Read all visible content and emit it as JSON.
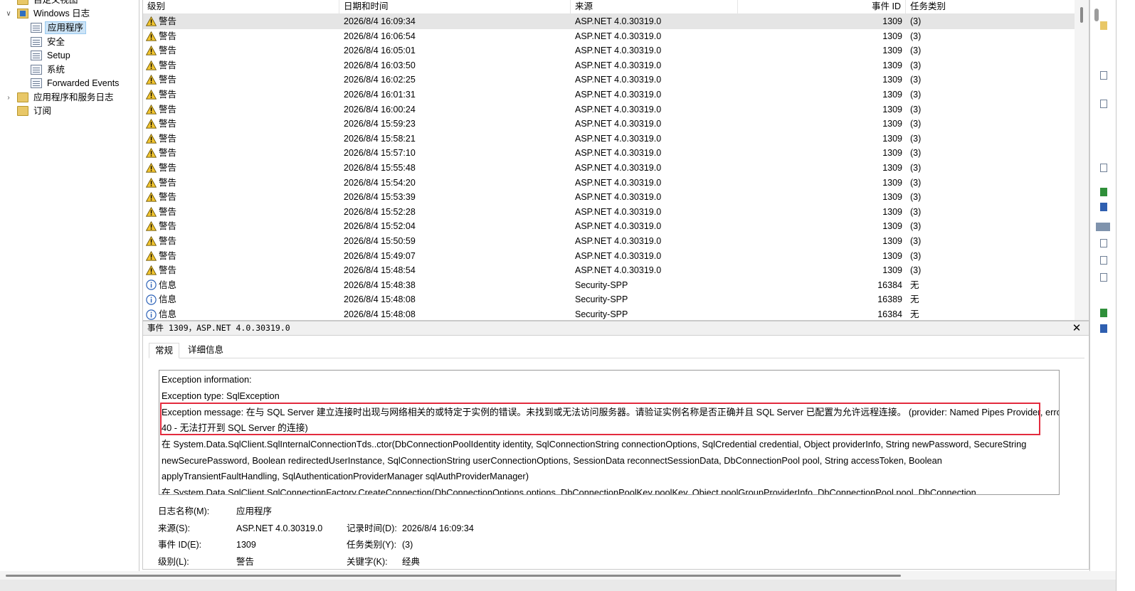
{
  "tree": {
    "custom_views": "自定义视图",
    "windows_logs": "Windows 日志",
    "items": [
      "应用程序",
      "安全",
      "Setup",
      "系统",
      "Forwarded Events"
    ],
    "app_service_logs": "应用程序和服务日志",
    "subscriptions": "订阅"
  },
  "list": {
    "headers": {
      "level": "级别",
      "datetime": "日期和时间",
      "source": "来源",
      "event_id": "事件 ID",
      "task": "任务类别"
    },
    "rows": [
      {
        "level": "警告",
        "type": "warning",
        "datetime": "2026/8/4 16:09:34",
        "source": "ASP.NET 4.0.30319.0",
        "event_id": "1309",
        "task": "(3)"
      },
      {
        "level": "警告",
        "type": "warning",
        "datetime": "2026/8/4 16:06:54",
        "source": "ASP.NET 4.0.30319.0",
        "event_id": "1309",
        "task": "(3)"
      },
      {
        "level": "警告",
        "type": "warning",
        "datetime": "2026/8/4 16:05:01",
        "source": "ASP.NET 4.0.30319.0",
        "event_id": "1309",
        "task": "(3)"
      },
      {
        "level": "警告",
        "type": "warning",
        "datetime": "2026/8/4 16:03:50",
        "source": "ASP.NET 4.0.30319.0",
        "event_id": "1309",
        "task": "(3)"
      },
      {
        "level": "警告",
        "type": "warning",
        "datetime": "2026/8/4 16:02:25",
        "source": "ASP.NET 4.0.30319.0",
        "event_id": "1309",
        "task": "(3)"
      },
      {
        "level": "警告",
        "type": "warning",
        "datetime": "2026/8/4 16:01:31",
        "source": "ASP.NET 4.0.30319.0",
        "event_id": "1309",
        "task": "(3)"
      },
      {
        "level": "警告",
        "type": "warning",
        "datetime": "2026/8/4 16:00:24",
        "source": "ASP.NET 4.0.30319.0",
        "event_id": "1309",
        "task": "(3)"
      },
      {
        "level": "警告",
        "type": "warning",
        "datetime": "2026/8/4 15:59:23",
        "source": "ASP.NET 4.0.30319.0",
        "event_id": "1309",
        "task": "(3)"
      },
      {
        "level": "警告",
        "type": "warning",
        "datetime": "2026/8/4 15:58:21",
        "source": "ASP.NET 4.0.30319.0",
        "event_id": "1309",
        "task": "(3)"
      },
      {
        "level": "警告",
        "type": "warning",
        "datetime": "2026/8/4 15:57:10",
        "source": "ASP.NET 4.0.30319.0",
        "event_id": "1309",
        "task": "(3)"
      },
      {
        "level": "警告",
        "type": "warning",
        "datetime": "2026/8/4 15:55:48",
        "source": "ASP.NET 4.0.30319.0",
        "event_id": "1309",
        "task": "(3)"
      },
      {
        "level": "警告",
        "type": "warning",
        "datetime": "2026/8/4 15:54:20",
        "source": "ASP.NET 4.0.30319.0",
        "event_id": "1309",
        "task": "(3)"
      },
      {
        "level": "警告",
        "type": "warning",
        "datetime": "2026/8/4 15:53:39",
        "source": "ASP.NET 4.0.30319.0",
        "event_id": "1309",
        "task": "(3)"
      },
      {
        "level": "警告",
        "type": "warning",
        "datetime": "2026/8/4 15:52:28",
        "source": "ASP.NET 4.0.30319.0",
        "event_id": "1309",
        "task": "(3)"
      },
      {
        "level": "警告",
        "type": "warning",
        "datetime": "2026/8/4 15:52:04",
        "source": "ASP.NET 4.0.30319.0",
        "event_id": "1309",
        "task": "(3)"
      },
      {
        "level": "警告",
        "type": "warning",
        "datetime": "2026/8/4 15:50:59",
        "source": "ASP.NET 4.0.30319.0",
        "event_id": "1309",
        "task": "(3)"
      },
      {
        "level": "警告",
        "type": "warning",
        "datetime": "2026/8/4 15:49:07",
        "source": "ASP.NET 4.0.30319.0",
        "event_id": "1309",
        "task": "(3)"
      },
      {
        "level": "警告",
        "type": "warning",
        "datetime": "2026/8/4 15:48:54",
        "source": "ASP.NET 4.0.30319.0",
        "event_id": "1309",
        "task": "(3)"
      },
      {
        "level": "信息",
        "type": "info",
        "datetime": "2026/8/4 15:48:38",
        "source": "Security-SPP",
        "event_id": "16384",
        "task": "无"
      },
      {
        "level": "信息",
        "type": "info",
        "datetime": "2026/8/4 15:48:08",
        "source": "Security-SPP",
        "event_id": "16389",
        "task": "无"
      },
      {
        "level": "信息",
        "type": "info",
        "datetime": "2026/8/4 15:48:08",
        "source": "Security-SPP",
        "event_id": "16384",
        "task": "无"
      }
    ]
  },
  "details": {
    "title": "事件 1309，ASP.NET 4.0.30319.0",
    "tabs": [
      "常规",
      "详细信息"
    ],
    "message_lines": [
      "Exception information:",
      "    Exception type: SqlException",
      "    Exception message: 在与 SQL Server 建立连接时出现与网络相关的或特定于实例的错误。未找到或无法访问服务器。请验证实例名称是否正确并且 SQL Server 已配置为允许远程连接。 (provider: Named Pipes Provider, error:",
      "40 - 无法打开到 SQL Server 的连接)",
      "   在 System.Data.SqlClient.SqlInternalConnectionTds..ctor(DbConnectionPoolIdentity identity, SqlConnectionString connectionOptions, SqlCredential credential, Object providerInfo, String newPassword, SecureString",
      "newSecurePassword, Boolean redirectedUserInstance, SqlConnectionString userConnectionOptions, SessionData reconnectSessionData, DbConnectionPool pool, String accessToken, Boolean",
      "applyTransientFaultHandling, SqlAuthenticationProviderManager sqlAuthProviderManager)",
      "   在 System.Data.SqlClient.SqlConnectionFactory.CreateConnection(DbConnectionOptions options, DbConnectionPoolKey poolKey, Object poolGroupProviderInfo, DbConnectionPool pool, DbConnection"
    ],
    "props": {
      "log_name_label": "日志名称(M):",
      "log_name": "应用程序",
      "source_label": "来源(S):",
      "source": "ASP.NET 4.0.30319.0",
      "logged_label": "记录时间(D):",
      "logged": "2026/8/4 16:09:34",
      "event_id_label": "事件 ID(E):",
      "event_id": "1309",
      "task_label": "任务类别(Y):",
      "task": "(3)",
      "level_label": "级别(L):",
      "level": "警告",
      "keywords_label": "关键字(K):",
      "keywords": "经典"
    }
  },
  "colors": {
    "selection": "#cce4f7",
    "highlight_border": "#e32b3e",
    "warning": "#f2c530"
  }
}
